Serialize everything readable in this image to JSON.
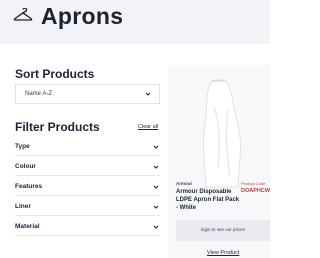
{
  "header": {
    "title": "Aprons",
    "icon": "hanger-icon"
  },
  "sort": {
    "title": "Sort Products",
    "selected": "Name A-Z"
  },
  "filter": {
    "title": "Filter Products",
    "clear_label": "Clear all",
    "items": [
      {
        "label": "Type"
      },
      {
        "label": "Colour"
      },
      {
        "label": "Features"
      },
      {
        "label": "Liner"
      },
      {
        "label": "Material"
      }
    ]
  },
  "product": {
    "brand": "Armour",
    "code_label": "Product Code",
    "code": "DOAPHCW",
    "name": "Armour Disposable LDPE Apron Flat Pack - White",
    "login_text": "login to see our prices",
    "view_label": "View Product"
  },
  "colors": {
    "header_bg": "#f2f3f7",
    "text": "#1e2233",
    "code_red": "#c0393b",
    "card_bg": "#f7f8fa"
  }
}
